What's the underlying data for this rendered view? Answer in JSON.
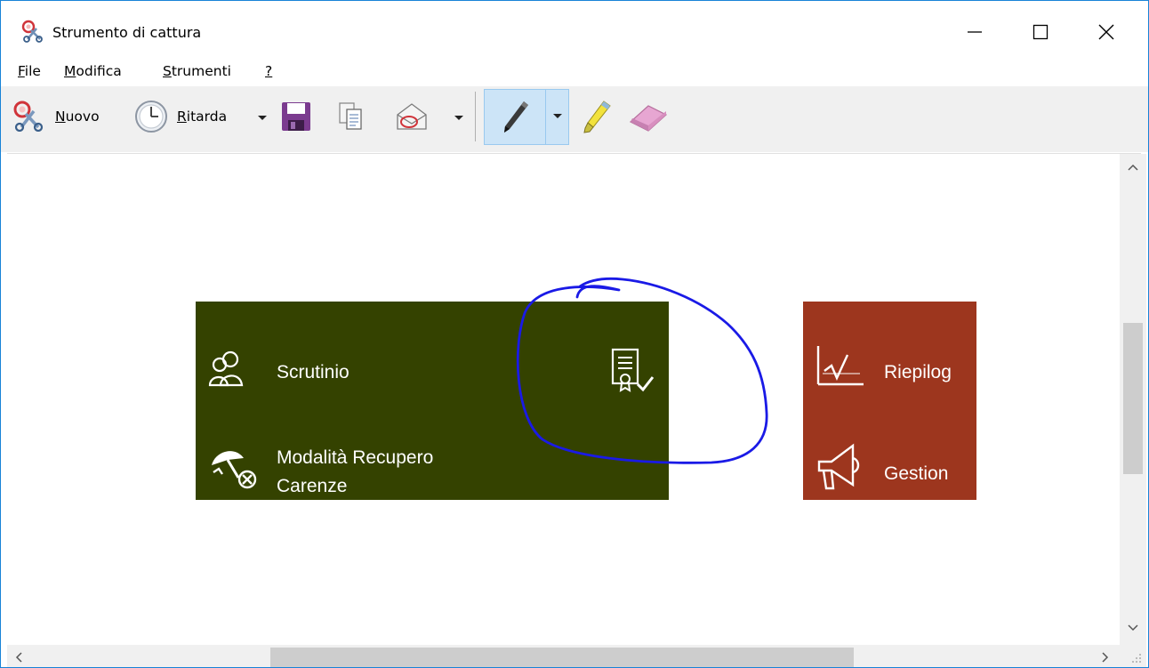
{
  "window": {
    "title": "Strumento di cattura",
    "icons": {
      "app": "scissors-icon",
      "minimize": "minimize-icon",
      "maximize": "maximize-icon",
      "close": "close-icon"
    }
  },
  "menubar": {
    "items": [
      {
        "first": "F",
        "rest": "ile"
      },
      {
        "first": "M",
        "rest": "odifica"
      },
      {
        "first": "S",
        "rest": "trumenti"
      },
      {
        "first": "?",
        "rest": ""
      }
    ]
  },
  "toolbar": {
    "new": {
      "first": "N",
      "rest": "uovo",
      "icon": "new-snip-icon"
    },
    "delay": {
      "first": "R",
      "rest": "itarda",
      "icon": "clock-icon"
    },
    "save_icon": "floppy-disk-icon",
    "copy_icon": "copy-icon",
    "send_icon": "email-envelope-icon",
    "pen_icon": "pen-icon",
    "highlighter_icon": "highlighter-icon",
    "eraser_icon": "eraser-icon",
    "colors": {
      "pen_active_bg": "#cce4f7",
      "toolbar_bg": "#f0f0f0"
    }
  },
  "capture": {
    "tile_green": {
      "color": "#344200",
      "items": [
        {
          "label": "Scrutinio",
          "icon": "people-icon"
        },
        {
          "label": "Modalità Recupero",
          "label2": "Carenze",
          "icon": "umbrella-x-icon"
        }
      ],
      "badge_icon": "certificate-check-icon"
    },
    "tile_red": {
      "color": "#9d361e",
      "items": [
        {
          "label": "Riepilog",
          "icon": "line-chart-icon"
        },
        {
          "label": "Gestion",
          "icon": "megaphone-icon"
        }
      ]
    },
    "annotation_color": "#1a1ae6"
  },
  "scrollbars": {
    "up": "chevron-up-icon",
    "down": "chevron-down-icon",
    "left": "chevron-left-icon",
    "right": "chevron-right-icon"
  }
}
